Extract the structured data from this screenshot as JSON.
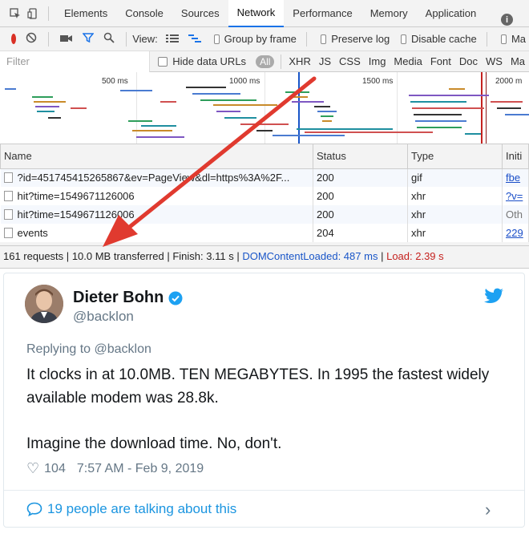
{
  "devtools": {
    "tabs": [
      "Elements",
      "Console",
      "Sources",
      "Network",
      "Performance",
      "Memory",
      "Application"
    ],
    "active_tab": "Network",
    "toolbar": {
      "view_label": "View:",
      "group_by_frame": "Group by frame",
      "preserve_log": "Preserve log",
      "disable_cache": "Disable cache",
      "more": "Ma"
    },
    "filter": {
      "placeholder": "Filter",
      "hide_data_urls": "Hide data URLs",
      "all": "All",
      "types": [
        "XHR",
        "JS",
        "CSS",
        "Img",
        "Media",
        "Font",
        "Doc",
        "WS",
        "Ma"
      ]
    },
    "timeline_ticks": [
      "500 ms",
      "1000 ms",
      "1500 ms",
      "2000 m"
    ],
    "table": {
      "headers": [
        "Name",
        "Status",
        "Type",
        "Initi"
      ],
      "rows": [
        {
          "name": "?id=451745415265867&ev=PageView&dl=https%3A%2F...",
          "status": "200",
          "type": "gif",
          "initiator": "fbe"
        },
        {
          "name": "hit?time=1549671126006",
          "status": "200",
          "type": "xhr",
          "initiator": "?v="
        },
        {
          "name": "hit?time=1549671126006",
          "status": "200",
          "type": "xhr",
          "initiator": "Oth"
        },
        {
          "name": "events",
          "status": "204",
          "type": "xhr",
          "initiator": "229"
        }
      ]
    },
    "summary": {
      "requests": "161 requests",
      "transferred": "10.0 MB transferred",
      "finish": "Finish: 3.11 s",
      "dcl": "DOMContentLoaded: 487 ms",
      "load": "Load: 2.39 s",
      "sep": "|"
    }
  },
  "tweet": {
    "name": "Dieter Bohn",
    "handle": "@backlon",
    "replying": "Replying to @backlon",
    "body": [
      "It clocks in at 10.0MB. TEN MEGABYTES. In 1995 the fastest widely available modem was 28.8k.",
      "Imagine the download time. No, don't."
    ],
    "likes": "104",
    "timestamp": "7:57 AM - Feb 9, 2019",
    "talking": "19 people are talking about this"
  },
  "colors": {
    "accent": "#1a73e8",
    "twitter_blue": "#1da1f2",
    "arrow_red": "#e03a2f",
    "load_red": "#c5221f"
  }
}
